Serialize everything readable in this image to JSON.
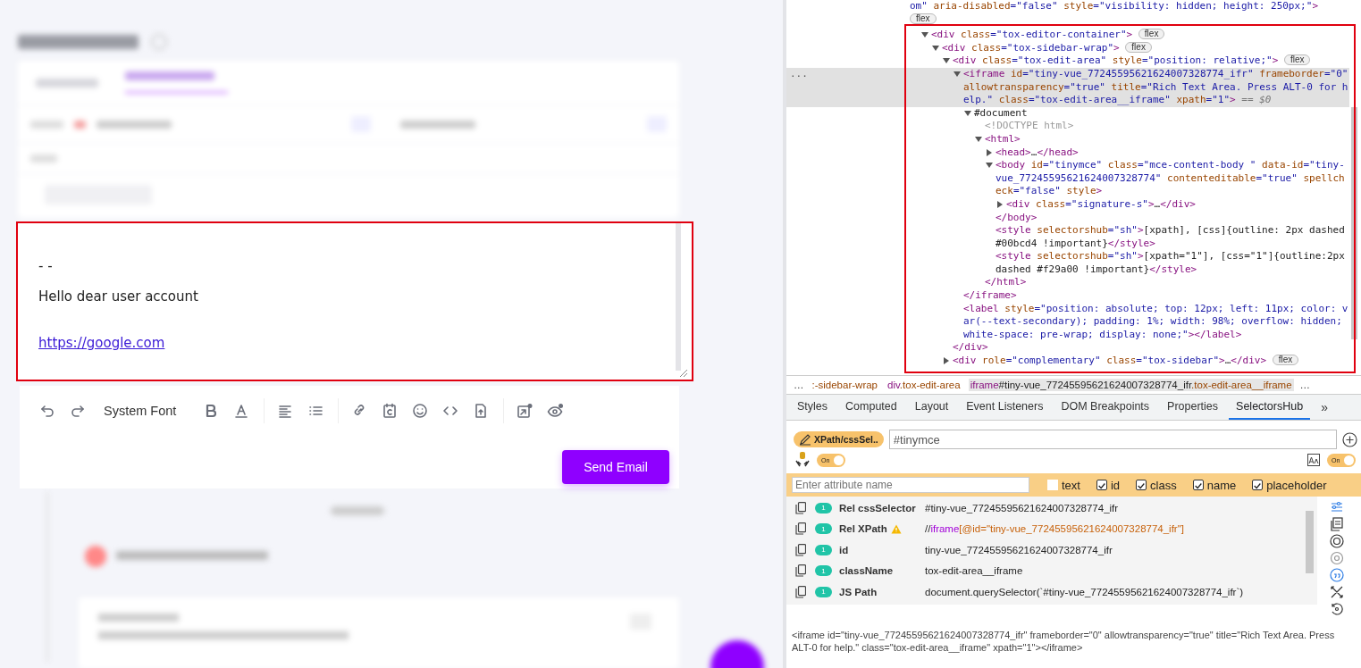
{
  "editor": {
    "paragraphs": [
      {
        "kind": "text",
        "text": "- -"
      },
      {
        "kind": "text",
        "text": "Hello dear user account"
      },
      {
        "kind": "link",
        "text": "https://google.com"
      }
    ],
    "font": "System Font",
    "send_button": "Send Email"
  },
  "elements": {
    "gutter": "...",
    "cut_line": {
      "badge": "flex",
      "parts": [
        {
          "kind": "value",
          "text": "om\""
        },
        {
          "kind": "attr",
          "text": " aria-disabled"
        },
        {
          "kind": "value",
          "text": "=\"false\""
        },
        {
          "kind": "attr",
          "text": " style"
        },
        {
          "kind": "value",
          "text": "=\"visibility: hidden; height: 250px;\""
        },
        {
          "kind": "tag",
          "text": ">"
        }
      ]
    },
    "nodes": [
      {
        "expanded": true,
        "selected": false,
        "badge": "flex",
        "parts": [
          {
            "kind": "tag",
            "text": "<div"
          },
          {
            "kind": "attr",
            "text": " class"
          },
          {
            "kind": "value",
            "text": "=\"tox-editor-container\""
          },
          {
            "kind": "tag",
            "text": ">"
          }
        ],
        "children": [
          {
            "expanded": true,
            "selected": false,
            "badge": "flex",
            "parts": [
              {
                "kind": "tag",
                "text": "<div"
              },
              {
                "kind": "attr",
                "text": " class"
              },
              {
                "kind": "value",
                "text": "=\"tox-sidebar-wrap\""
              },
              {
                "kind": "tag",
                "text": ">"
              }
            ],
            "children": [
              {
                "expanded": true,
                "selected": false,
                "badge": "flex",
                "close": "</div>",
                "parts": [
                  {
                    "kind": "tag",
                    "text": "<div"
                  },
                  {
                    "kind": "attr",
                    "text": " class"
                  },
                  {
                    "kind": "value",
                    "text": "=\"tox-edit-area\""
                  },
                  {
                    "kind": "attr",
                    "text": " style"
                  },
                  {
                    "kind": "value",
                    "text": "=\"position: relative;\""
                  },
                  {
                    "kind": "tag",
                    "text": ">"
                  }
                ],
                "children": [
                  {
                    "expanded": true,
                    "selected": true,
                    "close": "</iframe>",
                    "parts": [
                      {
                        "kind": "tag",
                        "text": "<iframe"
                      },
                      {
                        "kind": "attr",
                        "text": " id"
                      },
                      {
                        "kind": "value",
                        "text": "=\"tiny-vue_77245595621624007328774_ifr\""
                      },
                      {
                        "kind": "attr",
                        "text": " frameborder"
                      },
                      {
                        "kind": "value",
                        "text": "=\"0\""
                      },
                      {
                        "kind": "attr",
                        "text": " allowtransparency"
                      },
                      {
                        "kind": "value",
                        "text": "=\"true\""
                      },
                      {
                        "kind": "attr",
                        "text": " title"
                      },
                      {
                        "kind": "value",
                        "text": "=\"Rich Text Area. Press ALT-0 for help.\""
                      },
                      {
                        "kind": "attr",
                        "text": " class"
                      },
                      {
                        "kind": "value",
                        "text": "=\"tox-edit-area__iframe\""
                      },
                      {
                        "kind": "attr",
                        "text": " xpath"
                      },
                      {
                        "kind": "value",
                        "text": "=\"1\""
                      },
                      {
                        "kind": "tag",
                        "text": ">"
                      },
                      {
                        "kind": "hint",
                        "text": " == $0"
                      }
                    ],
                    "children": [
                      {
                        "expanded": true,
                        "selected": false,
                        "parts": [
                          {
                            "kind": "text",
                            "text": "#document"
                          }
                        ],
                        "children": [
                          {
                            "selected": false,
                            "parts": [
                              {
                                "kind": "muted",
                                "text": "<!DOCTYPE html>"
                              }
                            ]
                          },
                          {
                            "expanded": true,
                            "selected": false,
                            "close": "</html>",
                            "parts": [
                              {
                                "kind": "tag",
                                "text": "<html>"
                              }
                            ],
                            "children": [
                              {
                                "expanded": false,
                                "selected": false,
                                "parts": [
                                  {
                                    "kind": "tag",
                                    "text": "<head>"
                                  },
                                  {
                                    "kind": "text",
                                    "text": "…"
                                  },
                                  {
                                    "kind": "tag",
                                    "text": "</head>"
                                  }
                                ]
                              },
                              {
                                "expanded": true,
                                "selected": false,
                                "close": "</body>",
                                "parts": [
                                  {
                                    "kind": "tag",
                                    "text": "<body"
                                  },
                                  {
                                    "kind": "attr",
                                    "text": " id"
                                  },
                                  {
                                    "kind": "value",
                                    "text": "=\"tinymce\""
                                  },
                                  {
                                    "kind": "attr",
                                    "text": " class"
                                  },
                                  {
                                    "kind": "value",
                                    "text": "=\"mce-content-body \""
                                  },
                                  {
                                    "kind": "attr",
                                    "text": " data-id"
                                  },
                                  {
                                    "kind": "value",
                                    "text": "=\"tiny-vue_77245595621624007328774\""
                                  },
                                  {
                                    "kind": "attr",
                                    "text": " contenteditable"
                                  },
                                  {
                                    "kind": "value",
                                    "text": "=\"true\""
                                  },
                                  {
                                    "kind": "attr",
                                    "text": " spellcheck"
                                  },
                                  {
                                    "kind": "value",
                                    "text": "=\"false\""
                                  },
                                  {
                                    "kind": "attr",
                                    "text": " style"
                                  },
                                  {
                                    "kind": "tag",
                                    "text": ">"
                                  }
                                ],
                                "children": [
                                  {
                                    "expanded": false,
                                    "selected": false,
                                    "parts": [
                                      {
                                        "kind": "tag",
                                        "text": "<div"
                                      },
                                      {
                                        "kind": "attr",
                                        "text": " class"
                                      },
                                      {
                                        "kind": "value",
                                        "text": "=\"signature-s\""
                                      },
                                      {
                                        "kind": "tag",
                                        "text": ">"
                                      },
                                      {
                                        "kind": "text",
                                        "text": "…"
                                      },
                                      {
                                        "kind": "tag",
                                        "text": "</div>"
                                      }
                                    ]
                                  }
                                ]
                              },
                              {
                                "selected": false,
                                "parts": [
                                  {
                                    "kind": "tag",
                                    "text": "<style"
                                  },
                                  {
                                    "kind": "attr",
                                    "text": " selectorshub"
                                  },
                                  {
                                    "kind": "value",
                                    "text": "=\"sh\""
                                  },
                                  {
                                    "kind": "tag",
                                    "text": ">"
                                  },
                                  {
                                    "kind": "text",
                                    "text": "[xpath], [css]{outline: 2px dashed #00bcd4 !important}"
                                  },
                                  {
                                    "kind": "tag",
                                    "text": "</style>"
                                  }
                                ]
                              },
                              {
                                "selected": false,
                                "parts": [
                                  {
                                    "kind": "tag",
                                    "text": "<style"
                                  },
                                  {
                                    "kind": "attr",
                                    "text": " selectorshub"
                                  },
                                  {
                                    "kind": "value",
                                    "text": "=\"sh\""
                                  },
                                  {
                                    "kind": "tag",
                                    "text": ">"
                                  },
                                  {
                                    "kind": "text",
                                    "text": "[xpath=\"1\"], [css=\"1\"]{outline:2px dashed #f29a00 !important}"
                                  },
                                  {
                                    "kind": "tag",
                                    "text": "</style>"
                                  }
                                ]
                              }
                            ]
                          }
                        ]
                      }
                    ]
                  },
                  {
                    "selected": false,
                    "parts": [
                      {
                        "kind": "tag",
                        "text": "<label"
                      },
                      {
                        "kind": "attr",
                        "text": " style"
                      },
                      {
                        "kind": "value",
                        "text": "=\"position: absolute; top: 12px; left: 11px; color: var(--text-secondary); padding: 1%; width: 98%; overflow: hidden; white-space: pre-wrap; display: none;\""
                      },
                      {
                        "kind": "tag",
                        "text": "></label>"
                      }
                    ]
                  }
                ]
              },
              {
                "expanded": false,
                "selected": false,
                "badge": "flex",
                "parts": [
                  {
                    "kind": "tag",
                    "text": "<div"
                  },
                  {
                    "kind": "attr",
                    "text": " role"
                  },
                  {
                    "kind": "value",
                    "text": "=\"complementary\""
                  },
                  {
                    "kind": "attr",
                    "text": " class"
                  },
                  {
                    "kind": "value",
                    "text": "=\"tox-sidebar\""
                  },
                  {
                    "kind": "tag",
                    "text": ">"
                  },
                  {
                    "kind": "text",
                    "text": "…"
                  },
                  {
                    "kind": "tag",
                    "text": "</div>"
                  }
                ]
              }
            ]
          }
        ]
      }
    ],
    "breadcrumb": {
      "lead": "…",
      "trail": "…",
      "items": [
        {
          "selected": false,
          "parts": [
            {
              "kind": "attr",
              "text": ":-sidebar-wrap"
            }
          ]
        },
        {
          "selected": false,
          "parts": [
            {
              "kind": "tag",
              "text": "div"
            },
            {
              "kind": "attr",
              "text": ".tox-edit-area"
            }
          ]
        },
        {
          "selected": true,
          "parts": [
            {
              "kind": "tag",
              "text": "iframe"
            },
            {
              "kind": "text",
              "text": "#tiny-vue_77245595621624007328774_ifr"
            },
            {
              "kind": "attr",
              "text": ".tox-edit-area__iframe"
            }
          ]
        }
      ]
    }
  },
  "tabs": [
    {
      "label": "Styles",
      "selected": false
    },
    {
      "label": "Computed",
      "selected": false
    },
    {
      "label": "Layout",
      "selected": false
    },
    {
      "label": "Event Listeners",
      "selected": false
    },
    {
      "label": "DOM Breakpoints",
      "selected": false
    },
    {
      "label": "Properties",
      "selected": false
    },
    {
      "label": "SelectorsHub",
      "selected": true
    }
  ],
  "tabs_more": "»",
  "selectors_hub": {
    "mode_badge": "XPath/cssSel..",
    "query": "#tinymce",
    "toggles": [
      {
        "label": "On",
        "on": true
      },
      {
        "label": "On",
        "on": true
      }
    ],
    "attribute_placeholder": "Enter attribute name",
    "checkboxes": [
      {
        "label": "text",
        "checked": false
      },
      {
        "label": "id",
        "checked": true
      },
      {
        "label": "class",
        "checked": true
      },
      {
        "label": "name",
        "checked": true
      },
      {
        "label": "placeholder",
        "checked": true
      }
    ],
    "results": [
      {
        "label": "Rel cssSelector",
        "count": "1",
        "warning": false,
        "parts": [
          {
            "kind": "text",
            "text": "#tiny-vue_77245595621624007328774_ifr"
          }
        ]
      },
      {
        "label": "Rel XPath",
        "count": "1",
        "warning": true,
        "parts": [
          {
            "kind": "text",
            "text": "//"
          },
          {
            "kind": "tagname",
            "text": "iframe"
          },
          {
            "kind": "predicate",
            "text": "[@id=\"tiny-vue_77245595621624007328774_ifr\"]"
          }
        ]
      },
      {
        "label": "id",
        "count": "1",
        "warning": false,
        "parts": [
          {
            "kind": "text",
            "text": "tiny-vue_77245595621624007328774_ifr"
          }
        ]
      },
      {
        "label": "className",
        "count": "1",
        "warning": false,
        "parts": [
          {
            "kind": "text",
            "text": "tox-edit-area__iframe"
          }
        ]
      },
      {
        "label": "JS Path",
        "count": "1",
        "warning": false,
        "parts": [
          {
            "kind": "text",
            "text": "document.querySelector(`#tiny-vue_77245595621624007328774_ifr`)"
          }
        ]
      }
    ],
    "snippet": "<iframe id=\"tiny-vue_77245595621624007328774_ifr\" frameborder=\"0\" allowtransparency=\"true\" title=\"Rich Text Area. Press ALT-0 for help.\" class=\"tox-edit-area__iframe\" xpath=\"1\"></iframe>"
  }
}
